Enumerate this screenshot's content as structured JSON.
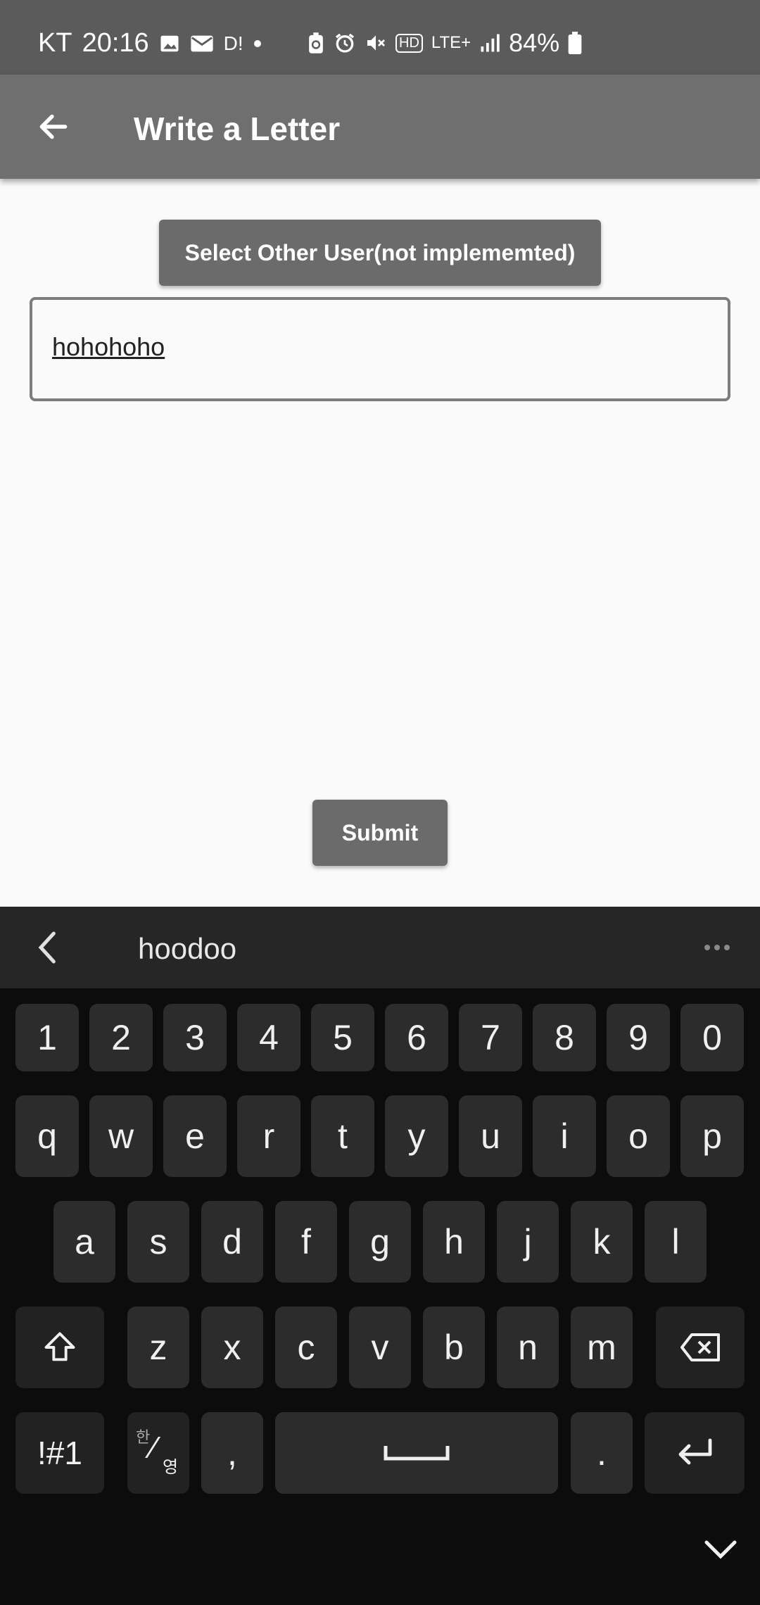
{
  "status_bar": {
    "carrier": "KT",
    "time": "20:16",
    "notification_icons": [
      "image-icon",
      "mail-icon",
      "d-app-icon",
      "dot-icon"
    ],
    "d_app_label": "D!",
    "network": "LTE+",
    "hd_label": "HD",
    "battery_percent": "84%"
  },
  "app_bar": {
    "title": "Write a Letter"
  },
  "content": {
    "select_user_label": "Select Other User(not implememted)",
    "letter_value": "hohohoho",
    "submit_label": "Submit"
  },
  "keyboard": {
    "suggestion": "hoodoo",
    "number_row": [
      "1",
      "2",
      "3",
      "4",
      "5",
      "6",
      "7",
      "8",
      "9",
      "0"
    ],
    "row1": [
      "q",
      "w",
      "e",
      "r",
      "t",
      "y",
      "u",
      "i",
      "o",
      "p"
    ],
    "row2": [
      "a",
      "s",
      "d",
      "f",
      "g",
      "h",
      "j",
      "k",
      "l"
    ],
    "row3": [
      "z",
      "x",
      "c",
      "v",
      "b",
      "n",
      "m"
    ],
    "symbols_label": "!#1",
    "lang_top": "한",
    "lang_bottom": "영",
    "comma": ",",
    "period": "."
  }
}
